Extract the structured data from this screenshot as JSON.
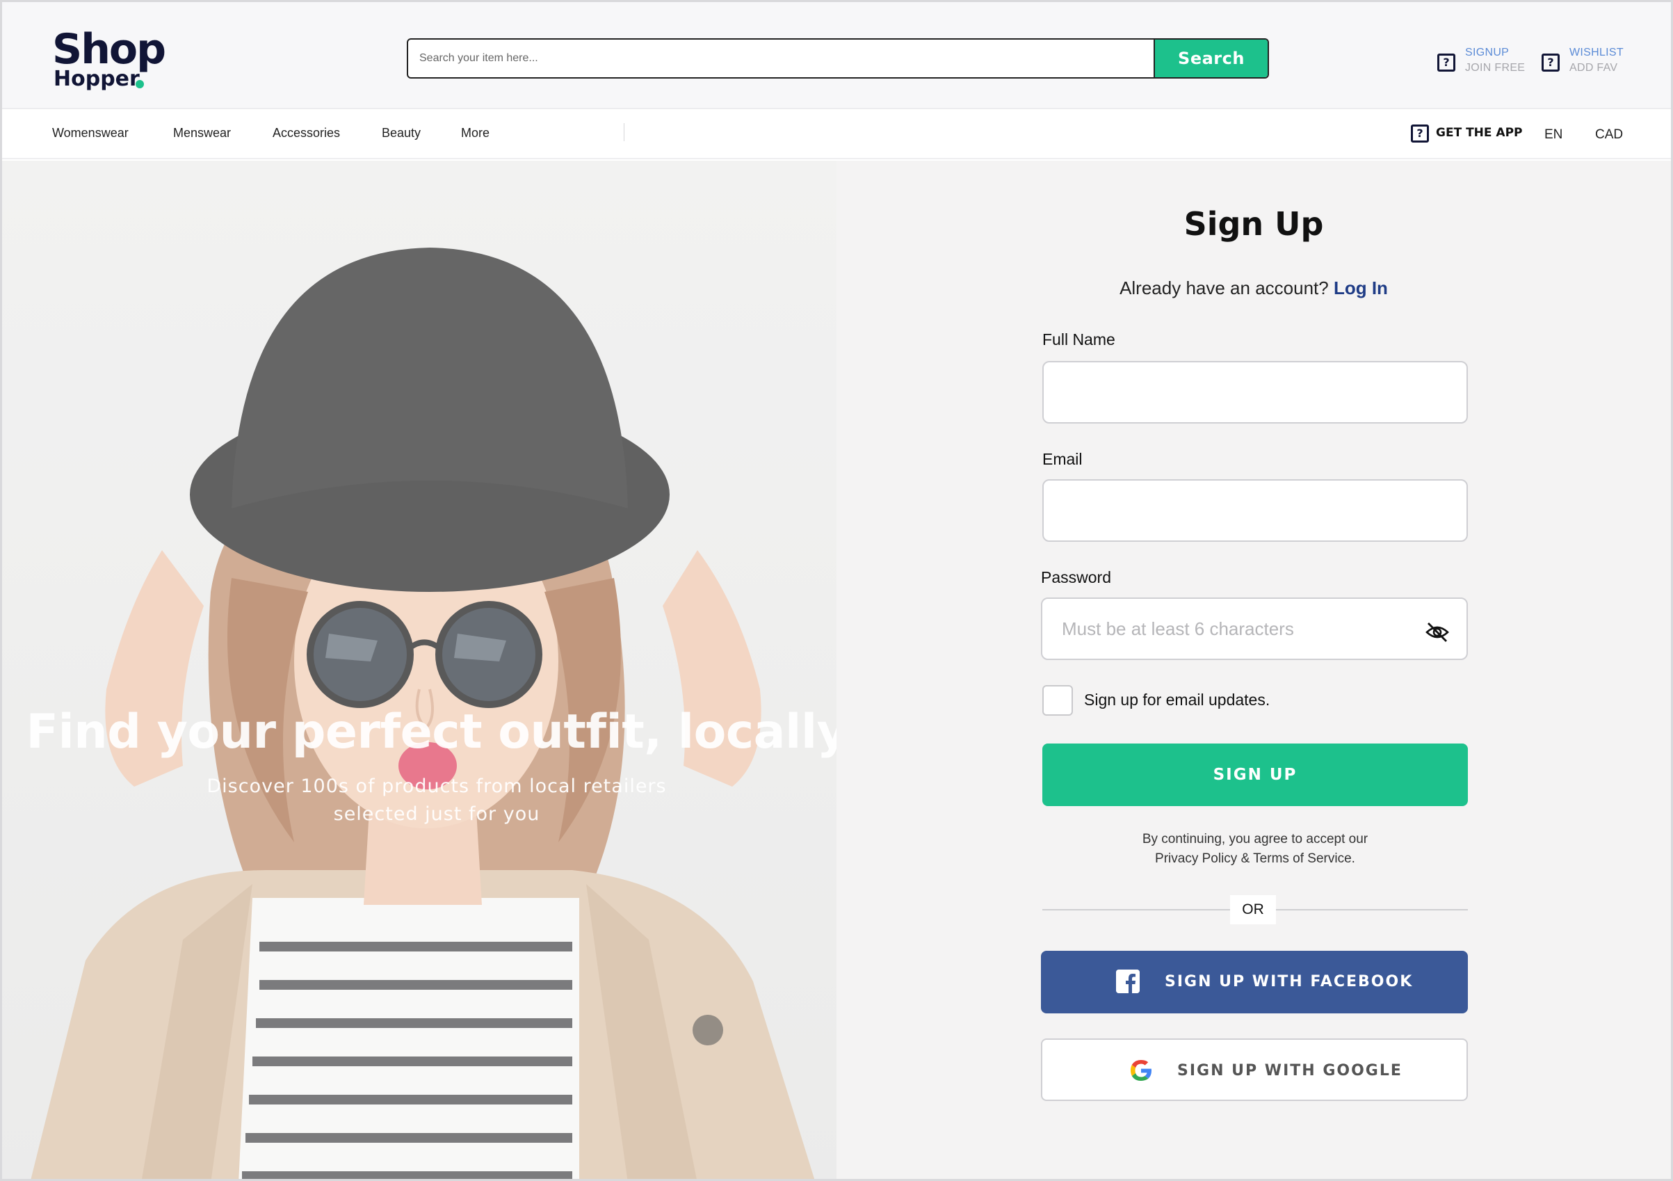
{
  "header": {
    "logo_line1": "Shop",
    "logo_line2": "Hopper",
    "search_placeholder": "Search your item here...",
    "search_button": "Search",
    "signup_top": "SIGNUP",
    "signup_bottom": "JOIN FREE",
    "wishlist_top": "WISHLIST",
    "wishlist_bottom": "ADD FAV"
  },
  "nav": {
    "items": [
      "Womenswear",
      "Menswear",
      "Accessories",
      "Beauty",
      "More"
    ],
    "get_app": "GET THE APP",
    "language": "EN",
    "currency": "CAD"
  },
  "hero": {
    "title": "Find your perfect outfit, locally",
    "subtitle_line1": "Discover 100s of products from local retailers",
    "subtitle_line2": "selected just for you"
  },
  "form": {
    "title": "Sign Up",
    "already_text": "Already have an account?",
    "login_link": "Log In",
    "full_name_label": "Full Name",
    "full_name_value": "",
    "email_label": "Email",
    "email_value": "",
    "password_label": "Password",
    "password_placeholder": "Must be at least 6 characters",
    "email_updates_label": "Sign up for email updates.",
    "email_updates_checked": false,
    "submit_label": "SIGN UP",
    "terms_line1": "By continuing, you agree to accept our",
    "terms_line2": "Privacy Policy & Terms of Service.",
    "or_text": "OR",
    "facebook_label": "SIGN UP WITH FACEBOOK",
    "google_label": "SIGN UP WITH GOOGLE"
  },
  "colors": {
    "brand_navy": "#111536",
    "accent_green": "#1dc18c",
    "link_blue": "#1f3c86",
    "facebook_blue": "#3b5998"
  },
  "icons": {
    "header_links": "help-square-icon",
    "password_toggle": "eye-off-icon",
    "facebook": "facebook-icon",
    "google": "google-icon"
  }
}
